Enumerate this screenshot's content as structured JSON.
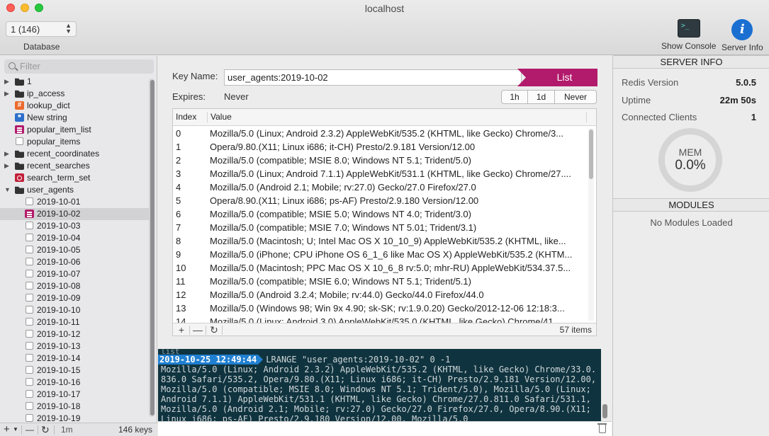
{
  "window": {
    "title": "localhost"
  },
  "toolbar": {
    "database_select": "1 (146)",
    "database_label": "Database",
    "show_console": "Show Console",
    "server_info": "Server Info"
  },
  "sidebar": {
    "filter_placeholder": "Filter",
    "items": [
      {
        "label": "1",
        "icon": "folder-icon",
        "expanded": false
      },
      {
        "label": "ip_access",
        "icon": "folder-icon",
        "expanded": false
      },
      {
        "label": "lookup_dict",
        "icon": "hash-icon"
      },
      {
        "label": "New string",
        "icon": "string-icon"
      },
      {
        "label": "popular_item_list",
        "icon": "list-icon"
      },
      {
        "label": "popular_items",
        "icon": "zset-icon"
      },
      {
        "label": "recent_coordinates",
        "icon": "folder-icon",
        "expanded": false
      },
      {
        "label": "recent_searches",
        "icon": "folder-icon",
        "expanded": false
      },
      {
        "label": "search_term_set",
        "icon": "set-icon"
      },
      {
        "label": "user_agents",
        "icon": "folder-icon",
        "expanded": true
      }
    ],
    "children": [
      {
        "label": "2019-10-01",
        "selected": false
      },
      {
        "label": "2019-10-02",
        "selected": true
      },
      {
        "label": "2019-10-03",
        "selected": false
      },
      {
        "label": "2019-10-04",
        "selected": false
      },
      {
        "label": "2019-10-05",
        "selected": false
      },
      {
        "label": "2019-10-06",
        "selected": false
      },
      {
        "label": "2019-10-07",
        "selected": false
      },
      {
        "label": "2019-10-08",
        "selected": false
      },
      {
        "label": "2019-10-09",
        "selected": false
      },
      {
        "label": "2019-10-10",
        "selected": false
      },
      {
        "label": "2019-10-11",
        "selected": false
      },
      {
        "label": "2019-10-12",
        "selected": false
      },
      {
        "label": "2019-10-13",
        "selected": false
      },
      {
        "label": "2019-10-14",
        "selected": false
      },
      {
        "label": "2019-10-15",
        "selected": false
      },
      {
        "label": "2019-10-16",
        "selected": false
      },
      {
        "label": "2019-10-17",
        "selected": false
      },
      {
        "label": "2019-10-18",
        "selected": false
      },
      {
        "label": "2019-10-19",
        "selected": false
      }
    ],
    "footer": {
      "add": "+",
      "remove": "—",
      "interval": "1m",
      "key_count": "146 keys"
    }
  },
  "editor": {
    "key_name_label": "Key Name:",
    "key_name_value": "user_agents:2019-10-02",
    "type_label": "List",
    "expires_label": "Expires:",
    "expires_value": "Never",
    "ttl_buttons": [
      "1h",
      "1d",
      "Never"
    ],
    "table": {
      "col_index": "Index",
      "col_value": "Value",
      "rows": [
        {
          "index": "0",
          "value": "Mozilla/5.0 (Linux; Android 2.3.2) AppleWebKit/535.2 (KHTML, like Gecko) Chrome/3..."
        },
        {
          "index": "1",
          "value": "Opera/9.80.(X11; Linux i686; it-CH) Presto/2.9.181 Version/12.00"
        },
        {
          "index": "2",
          "value": "Mozilla/5.0 (compatible; MSIE 8.0; Windows NT 5.1; Trident/5.0)"
        },
        {
          "index": "3",
          "value": "Mozilla/5.0 (Linux; Android 7.1.1) AppleWebKit/531.1 (KHTML, like Gecko) Chrome/27...."
        },
        {
          "index": "4",
          "value": "Mozilla/5.0 (Android 2.1; Mobile; rv:27.0) Gecko/27.0 Firefox/27.0"
        },
        {
          "index": "5",
          "value": "Opera/8.90.(X11; Linux i686; ps-AF) Presto/2.9.180 Version/12.00"
        },
        {
          "index": "6",
          "value": "Mozilla/5.0 (compatible; MSIE 5.0; Windows NT 4.0; Trident/3.0)"
        },
        {
          "index": "7",
          "value": "Mozilla/5.0 (compatible; MSIE 7.0; Windows NT 5.01; Trident/3.1)"
        },
        {
          "index": "8",
          "value": "Mozilla/5.0 (Macintosh; U; Intel Mac OS X 10_10_9) AppleWebKit/535.2 (KHTML, like..."
        },
        {
          "index": "9",
          "value": "Mozilla/5.0 (iPhone; CPU iPhone OS 6_1_6 like Mac OS X) AppleWebKit/535.2 (KHTM..."
        },
        {
          "index": "10",
          "value": "Mozilla/5.0 (Macintosh; PPC Mac OS X 10_6_8 rv:5.0; mhr-RU) AppleWebKit/534.37.5..."
        },
        {
          "index": "11",
          "value": "Mozilla/5.0 (compatible; MSIE 6.0; Windows NT 5.1; Trident/5.1)"
        },
        {
          "index": "12",
          "value": "Mozilla/5.0 (Android 3.2.4; Mobile; rv:44.0) Gecko/44.0 Firefox/44.0"
        },
        {
          "index": "13",
          "value": "Mozilla/5.0 (Windows 98; Win 9x 4.90; sk-SK; rv:1.9.0.20) Gecko/2012-12-06 12:18:3..."
        },
        {
          "index": "14",
          "value": "Mozilla/5.0 (Linux; Android 3.0) AppleWebKit/535.0 (KHTML, like Gecko) Chrome/41..."
        }
      ],
      "item_count": "57 items"
    }
  },
  "console": {
    "previous": "list",
    "timestamp": "2019-10-25 12:49:44",
    "command": "LRANGE \"user_agents:2019-10-02\" 0 -1",
    "output": "Mozilla/5.0 (Linux; Android 2.3.2) AppleWebKit/535.2 (KHTML, like Gecko) Chrome/33.0.836.0 Safari/535.2, Opera/9.80.(X11; Linux i686; it-CH) Presto/2.9.181 Version/12.00, Mozilla/5.0 (compatible; MSIE 8.0; Windows NT 5.1; Trident/5.0), Mozilla/5.0 (Linux; Android 7.1.1) AppleWebKit/531.1 (KHTML, like Gecko) Chrome/27.0.811.0 Safari/531.1, Mozilla/5.0 (Android 2.1; Mobile; rv:27.0) Gecko/27.0 Firefox/27.0, Opera/8.90.(X11; Linux i686; ps-AF) Presto/2.9.180 Version/12.00, Mozilla/5.0"
  },
  "server_info": {
    "header": "SERVER INFO",
    "redis_version_label": "Redis Version",
    "redis_version": "5.0.5",
    "uptime_label": "Uptime",
    "uptime": "22m 50s",
    "clients_label": "Connected Clients",
    "clients": "1",
    "mem_label": "MEM",
    "mem_value": "0.0%",
    "modules_header": "MODULES",
    "modules_empty": "No Modules Loaded"
  },
  "colors": {
    "list_accent": "#b21a6b",
    "console_bg": "#10343f",
    "timestamp_bg": "#1f7fd1"
  }
}
